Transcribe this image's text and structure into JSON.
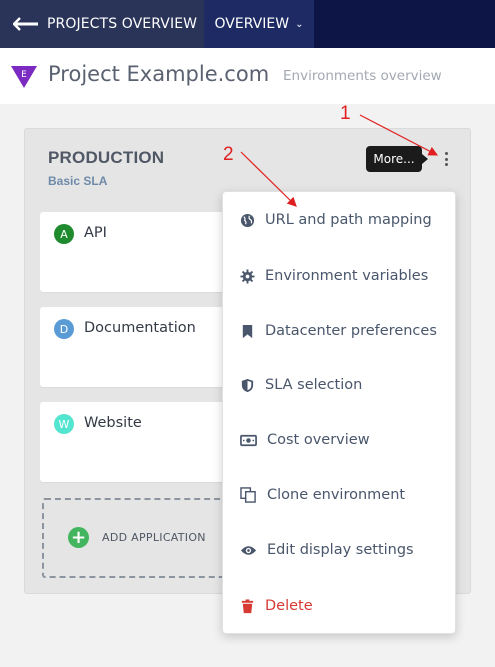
{
  "nav": {
    "back_label": "PROJECTS OVERVIEW",
    "overview_label": "OVERVIEW"
  },
  "header": {
    "logo_letter": "E",
    "project_title": "Project Example.com",
    "subtitle": "Environments overview"
  },
  "environment": {
    "name": "PRODUCTION",
    "sla": "Basic SLA",
    "more_tooltip": "More..."
  },
  "applications": [
    {
      "initial": "A",
      "name": "API",
      "color": "#1f8a2e"
    },
    {
      "initial": "D",
      "name": "Documentation",
      "color": "#5b9bd5"
    },
    {
      "initial": "W",
      "name": "Website",
      "color": "#54e5d0"
    }
  ],
  "add_application_label": "ADD APPLICATION",
  "menu": {
    "items": [
      {
        "label": "URL and path mapping",
        "icon": "globe-icon"
      },
      {
        "label": "Environment variables",
        "icon": "gear-icon"
      },
      {
        "label": "Datacenter preferences",
        "icon": "bookmark-icon"
      },
      {
        "label": "SLA selection",
        "icon": "shield-icon"
      },
      {
        "label": "Cost overview",
        "icon": "money-icon"
      },
      {
        "label": "Clone environment",
        "icon": "clone-icon"
      },
      {
        "label": "Edit display settings",
        "icon": "eye-icon"
      },
      {
        "label": "Delete",
        "icon": "trash-icon"
      }
    ]
  },
  "annotations": [
    "1",
    "2"
  ],
  "colors": {
    "nav_bg": "#0d1446",
    "accent_purple": "#7b2ac2",
    "danger": "#d63a33",
    "annotation": "#e02020"
  }
}
